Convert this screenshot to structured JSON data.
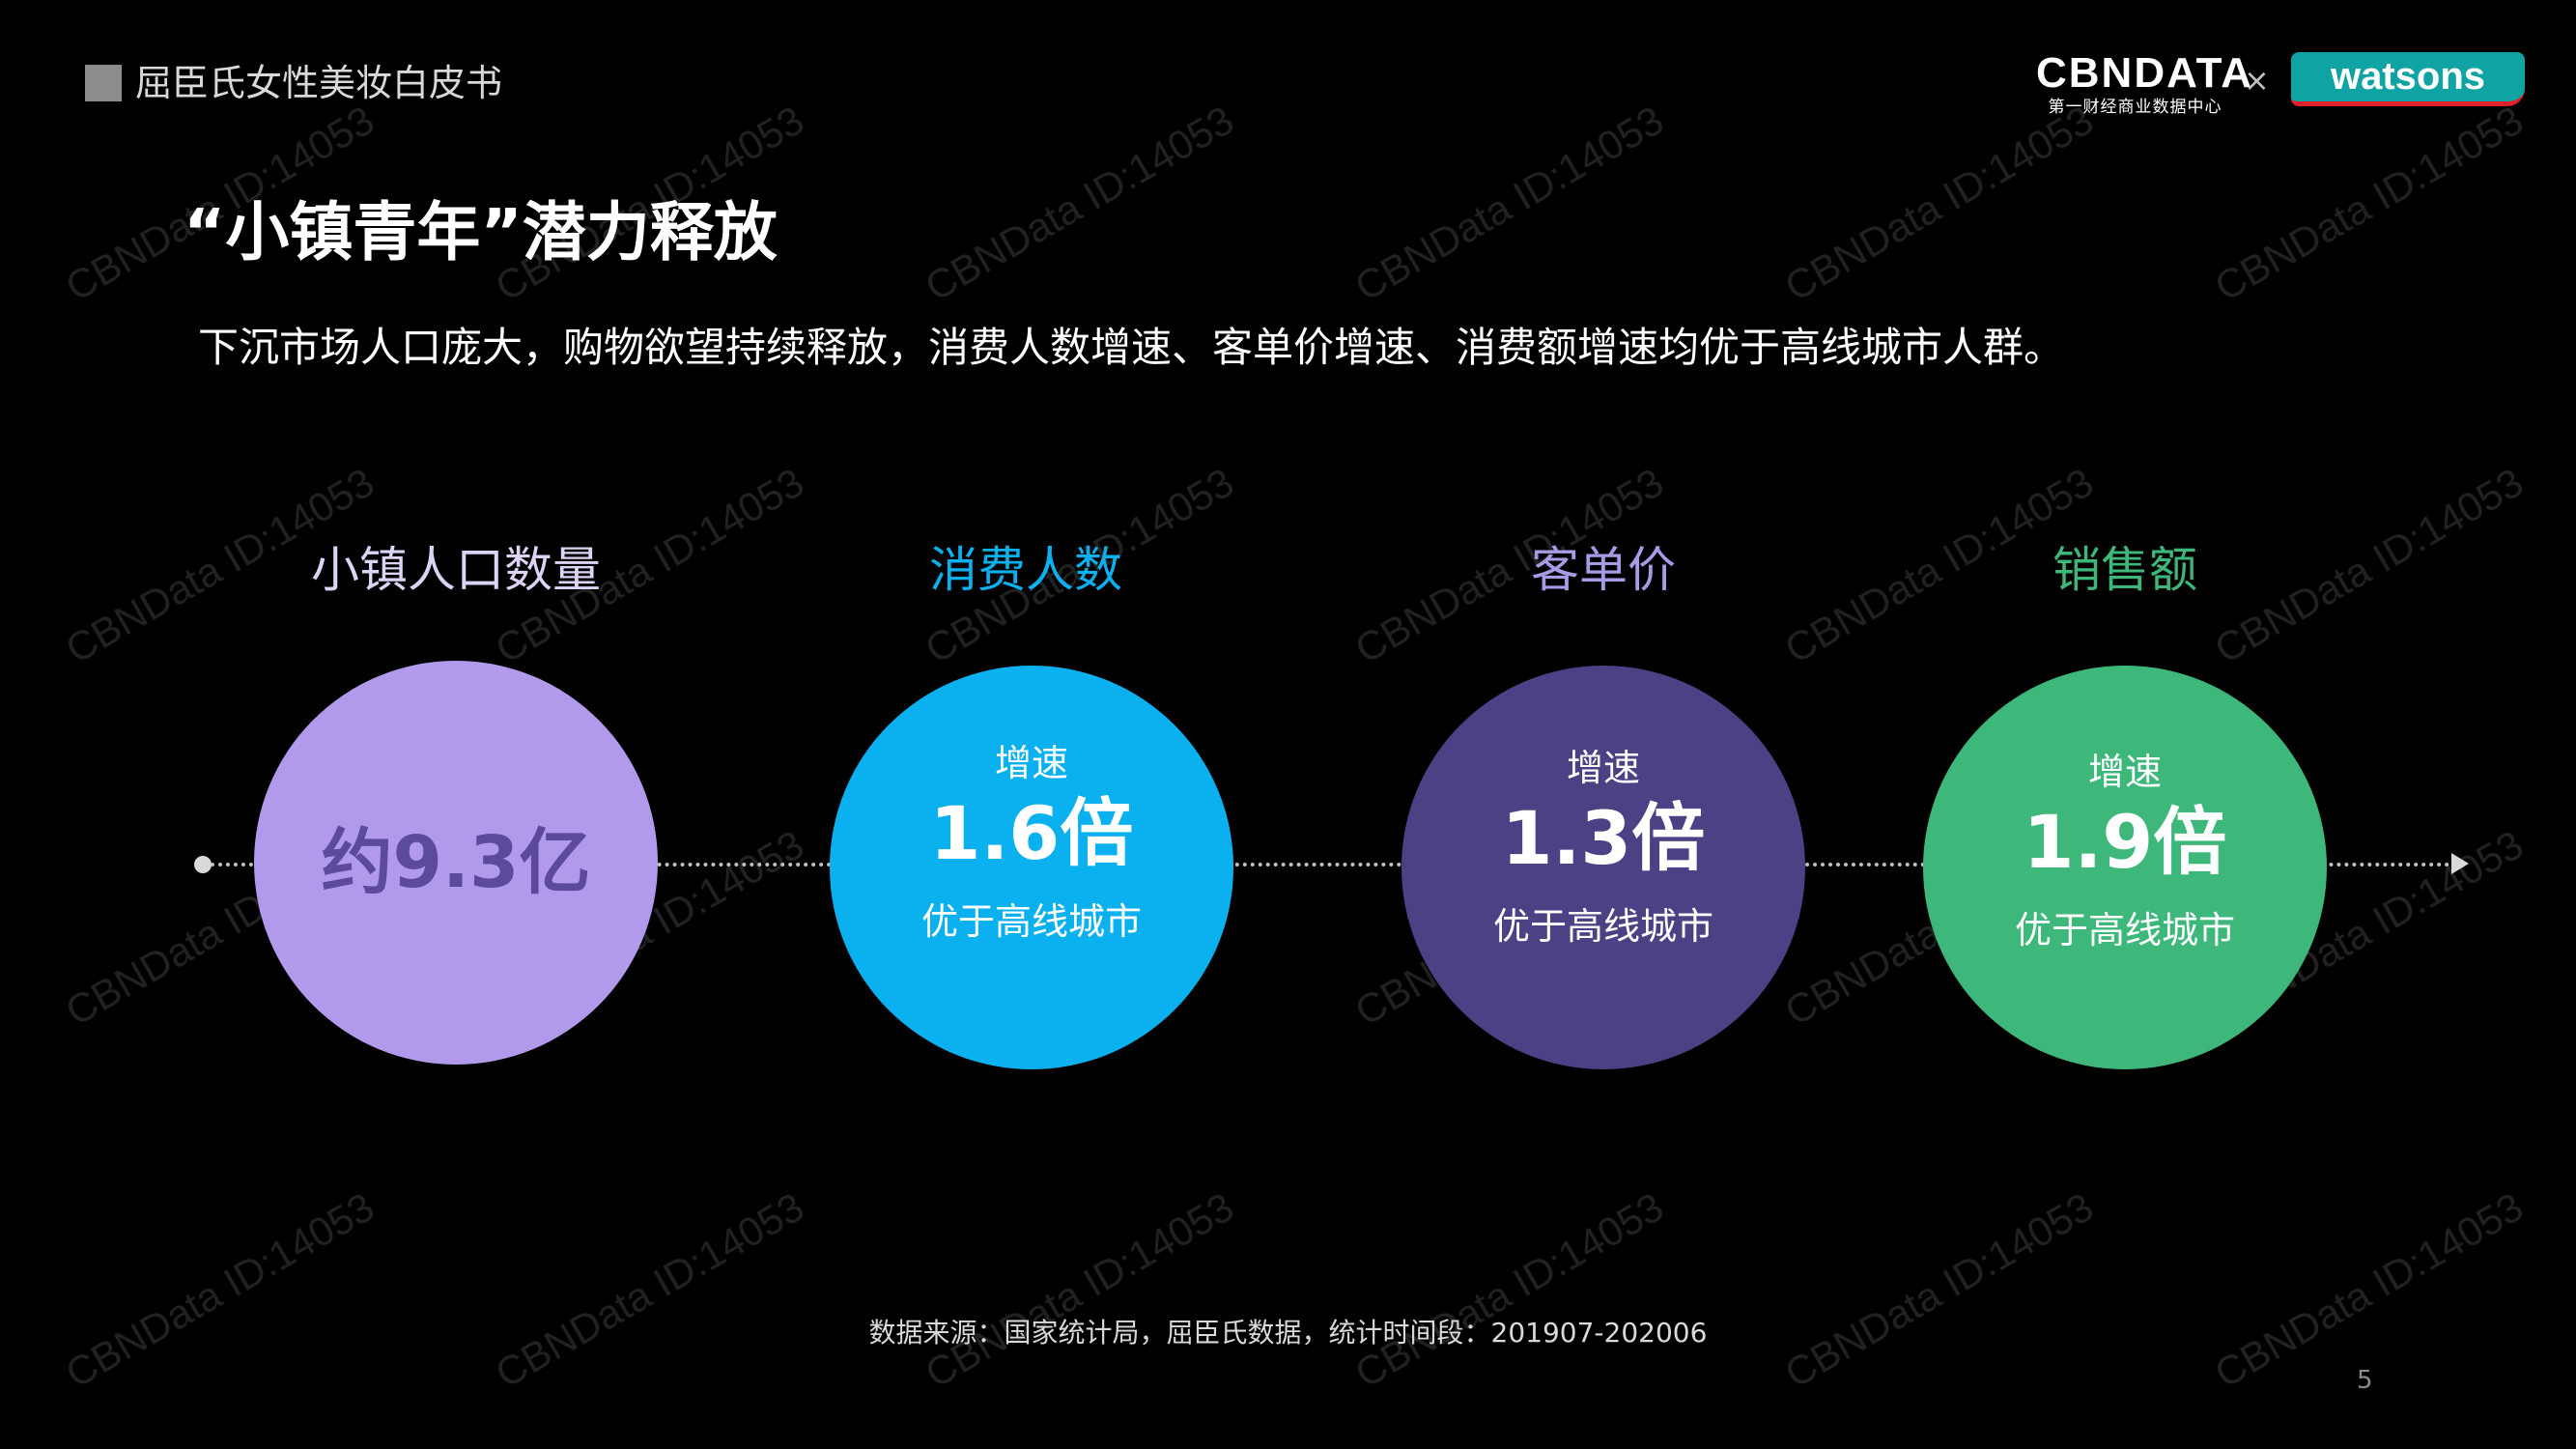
{
  "header": {
    "report_title": "屈臣氏女性美妆白皮书",
    "brand_cbn": "CBNDATA",
    "brand_cbn_sub": "第一财经商业数据中心",
    "brand_separator": "×",
    "brand_watsons": "watsons"
  },
  "slide": {
    "title": "“小镇青年”潜力释放",
    "subtitle": "下沉市场人口庞大，购物欲望持续释放，消费人数增速、客单价增速、消费额增速均优于高线城市人群。"
  },
  "metrics": [
    {
      "label": "小镇人口数量",
      "value": "约9.3亿",
      "label_color": "#dcd3f5",
      "circle_color": "#b19aeb"
    },
    {
      "label": "消费人数",
      "top": "增速",
      "value": "1.6倍",
      "bottom": "优于高线城市",
      "label_color": "#0bb0ef",
      "circle_color": "#0bb0ef"
    },
    {
      "label": "客单价",
      "top": "增速",
      "value": "1.3倍",
      "bottom": "优于高线城市",
      "label_color": "#a89be6",
      "circle_color": "#4d4085"
    },
    {
      "label": "销售额",
      "top": "增速",
      "value": "1.9倍",
      "bottom": "优于高线城市",
      "label_color": "#3db87a",
      "circle_color": "#3db87a"
    }
  ],
  "footnote": "数据来源：国家统计局，屈臣氏数据，统计时间段：201907-202006",
  "page_number": "5",
  "watermark_text": "CBNData ID:14053"
}
